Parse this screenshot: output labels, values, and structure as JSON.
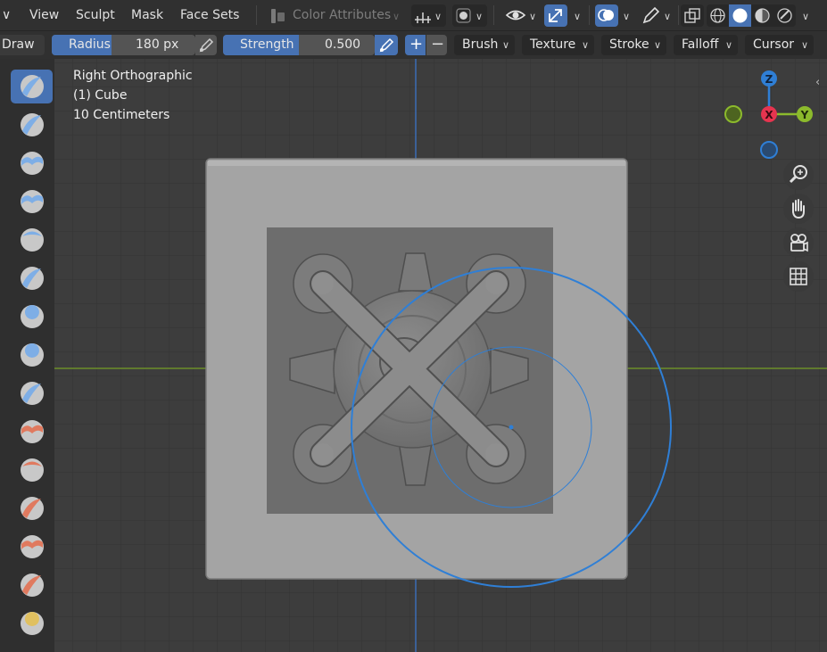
{
  "menu": {
    "items": [
      "View",
      "Sculpt",
      "Mask",
      "Face Sets"
    ],
    "color_attributes_label": "Color Attributes"
  },
  "toolbar": {
    "tool_name": "Draw",
    "radius_label": "Radius",
    "radius_value": "180 px",
    "strength_label": "Strength",
    "strength_value": "0.500",
    "strength_fraction": 0.5,
    "plus_label": "+",
    "minus_label": "−",
    "dropdowns": [
      "Brush",
      "Texture",
      "Stroke",
      "Falloff",
      "Cursor"
    ]
  },
  "viewport": {
    "view_name": "Right Orthographic",
    "object_name": "(1) Cube",
    "scale_text": "10 Centimeters"
  },
  "gizmo": {
    "x_label": "X",
    "y_label": "Y",
    "z_label": "Z",
    "x_color": "#e6344f",
    "y_color": "#8cba2c",
    "z_color": "#2f7fd6"
  },
  "brush_cursor_color": "#2f7fd6",
  "brush_tools": [
    "draw-brush-icon",
    "draw-sharp-brush-icon",
    "clay-brush-icon",
    "clay-strips-brush-icon",
    "clay-thumb-brush-icon",
    "layer-brush-icon",
    "inflate-brush-icon",
    "blob-brush-icon",
    "crease-brush-icon",
    "smooth-brush-icon",
    "flatten-brush-icon",
    "fill-brush-icon",
    "scrape-brush-icon",
    "multiplane-scrape-brush-icon",
    "pinch-brush-icon"
  ],
  "nav_buttons": [
    "zoom-icon",
    "hand-pan-icon",
    "camera-icon",
    "grid-icon"
  ]
}
